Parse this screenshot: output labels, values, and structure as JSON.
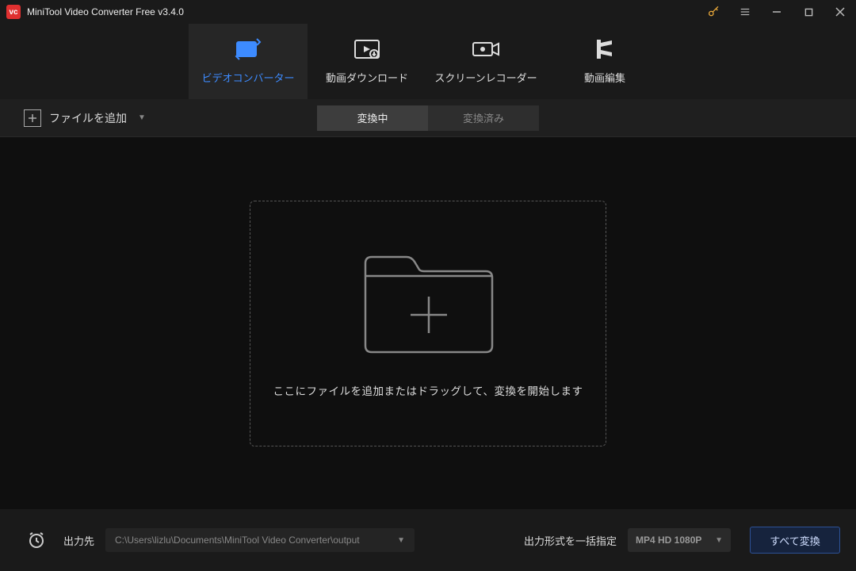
{
  "app": {
    "title": "MiniTool Video Converter Free v3.4.0"
  },
  "tabs": [
    {
      "label": "ビデオコンバーター"
    },
    {
      "label": "動画ダウンロード"
    },
    {
      "label": "スクリーンレコーダー"
    },
    {
      "label": "動画編集"
    }
  ],
  "toolbar": {
    "add_file": "ファイルを追加",
    "seg_converting": "変換中",
    "seg_converted": "変換済み"
  },
  "dropzone": {
    "text": "ここにファイルを追加またはドラッグして、変換を開始します"
  },
  "footer": {
    "output_label": "出力先",
    "output_path": "C:\\Users\\lizlu\\Documents\\MiniTool Video Converter\\output",
    "format_label": "出力形式を一括指定",
    "format_value": "MP4 HD 1080P",
    "convert_all": "すべて変換"
  }
}
